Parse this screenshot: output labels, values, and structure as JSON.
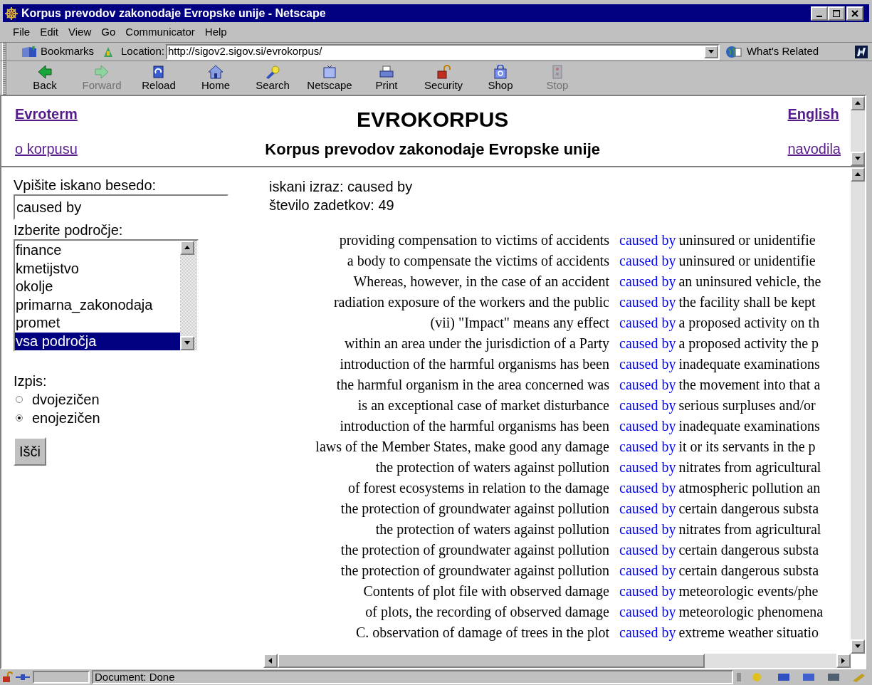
{
  "window": {
    "title": "Korpus prevodov zakonodaje Evropske unije - Netscape"
  },
  "menu": [
    {
      "label": "File"
    },
    {
      "label": "Edit"
    },
    {
      "label": "View"
    },
    {
      "label": "Go"
    },
    {
      "label": "Communicator"
    },
    {
      "label": "Help"
    }
  ],
  "location_bar": {
    "bookmarks": "Bookmarks",
    "label": "Location:",
    "url": "http://sigov2.sigov.si/evrokorpus/",
    "related": "What's Related"
  },
  "toolbar": [
    {
      "label": "Back",
      "disabled": false
    },
    {
      "label": "Forward",
      "disabled": true
    },
    {
      "label": "Reload",
      "disabled": false
    },
    {
      "label": "Home",
      "disabled": false
    },
    {
      "label": "Search",
      "disabled": false
    },
    {
      "label": "Netscape",
      "disabled": false
    },
    {
      "label": "Print",
      "disabled": false
    },
    {
      "label": "Security",
      "disabled": false
    },
    {
      "label": "Shop",
      "disabled": false
    },
    {
      "label": "Stop",
      "disabled": true
    }
  ],
  "header": {
    "top_left_link": "Evroterm",
    "title": "EVROKORPUS",
    "top_right_link": "English",
    "bottom_left_link": "o korpusu",
    "subtitle": "Korpus prevodov zakonodaje Evropske unije",
    "bottom_right_link": "navodila"
  },
  "search_form": {
    "query_label": "Vpišite iskano besedo:",
    "query": "caused by",
    "area_label": "Izberite področje:",
    "areas": [
      {
        "label": "finance",
        "selected": false
      },
      {
        "label": "kmetijstvo",
        "selected": false
      },
      {
        "label": "okolje",
        "selected": false
      },
      {
        "label": "primarna_zakonodaja",
        "selected": false
      },
      {
        "label": "promet",
        "selected": false
      },
      {
        "label": "vsa področja",
        "selected": true
      }
    ],
    "output_label": "Izpis:",
    "output_options": [
      {
        "label": "dvojezičen",
        "selected": false
      },
      {
        "label": "enojezičen",
        "selected": true
      }
    ],
    "submit": "Išči"
  },
  "results": {
    "query_line": "iskani izraz: caused by",
    "count_line": "število zadetkov: 49",
    "rows": [
      {
        "left": "providing compensation to victims of accidents",
        "match": "caused by",
        "right": "uninsured or unidentifie"
      },
      {
        "left": "a body to compensate the victims of accidents",
        "match": "caused by",
        "right": "uninsured or unidentifie"
      },
      {
        "left": "Whereas, however, in the case of an accident",
        "match": "caused by",
        "right": "an uninsured vehicle, the"
      },
      {
        "left": "radiation exposure of the workers and the public",
        "match": "caused by",
        "right": "the facility shall be kept"
      },
      {
        "left": "(vii) \"Impact\" means any effect",
        "match": "caused by",
        "right": "a proposed activity on th"
      },
      {
        "left": "within an area under the jurisdiction of a Party",
        "match": "caused by",
        "right": "a proposed activity the p"
      },
      {
        "left": "introduction of the harmful organisms has been",
        "match": "caused by",
        "right": "inadequate examinations"
      },
      {
        "left": "the harmful organism in the area concerned was",
        "match": "caused by",
        "right": "the movement into that a"
      },
      {
        "left": "is an exceptional case of market disturbance",
        "match": "caused by",
        "right": "serious surpluses and/or"
      },
      {
        "left": "introduction of the harmful organisms has been",
        "match": "caused by",
        "right": "inadequate examinations"
      },
      {
        "left": "laws of the Member States, make good any damage",
        "match": "caused by",
        "right": "it or its servants in the p"
      },
      {
        "left": "the protection of waters against pollution",
        "match": "caused by",
        "right": "nitrates from agricultural"
      },
      {
        "left": "of forest ecosystems in relation to the damage",
        "match": "caused by",
        "right": "atmospheric pollution an"
      },
      {
        "left": "the protection of groundwater against pollution",
        "match": "caused by",
        "right": "certain dangerous substa"
      },
      {
        "left": "the protection of waters against pollution",
        "match": "caused by",
        "right": "nitrates from agricultural"
      },
      {
        "left": "the protection of groundwater against pollution",
        "match": "caused by",
        "right": "certain dangerous substa"
      },
      {
        "left": "the protection of groundwater against pollution",
        "match": "caused by",
        "right": "certain dangerous substa"
      },
      {
        "left": "Contents of plot file with observed damage",
        "match": "caused by",
        "right": "meteorologic events/phe"
      },
      {
        "left": "of plots, the recording of observed damage",
        "match": "caused by",
        "right": "meteorologic phenomena"
      },
      {
        "left": "C. observation of damage of trees in the plot",
        "match": "caused by",
        "right": "extreme weather situatio"
      }
    ]
  },
  "status_bar": {
    "text": "Document: Done"
  }
}
